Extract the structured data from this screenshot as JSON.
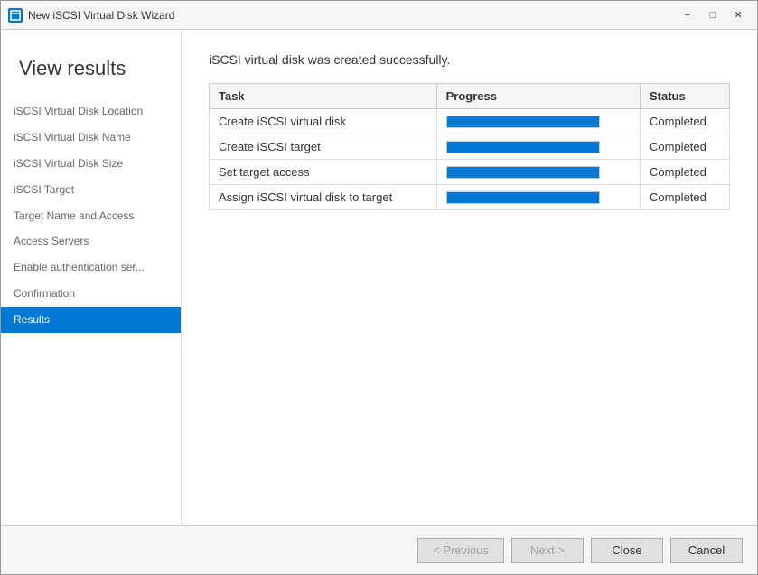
{
  "window": {
    "title": "New iSCSI Virtual Disk Wizard",
    "icon": "disk"
  },
  "titlebar": {
    "minimize_label": "−",
    "maximize_label": "□",
    "close_label": "✕"
  },
  "sidebar": {
    "page_title": "View results",
    "nav_items": [
      {
        "id": "iscsi-location",
        "label": "iSCSI Virtual Disk Location",
        "active": false
      },
      {
        "id": "iscsi-name",
        "label": "iSCSI Virtual Disk Name",
        "active": false
      },
      {
        "id": "iscsi-size",
        "label": "iSCSI Virtual Disk Size",
        "active": false
      },
      {
        "id": "iscsi-target",
        "label": "iSCSI Target",
        "active": false
      },
      {
        "id": "target-name-access",
        "label": "Target Name and Access",
        "active": false
      },
      {
        "id": "access-servers",
        "label": "Access Servers",
        "active": false
      },
      {
        "id": "enable-auth",
        "label": "Enable authentication ser...",
        "active": false
      },
      {
        "id": "confirmation",
        "label": "Confirmation",
        "active": false
      },
      {
        "id": "results",
        "label": "Results",
        "active": true
      }
    ]
  },
  "main": {
    "success_message": "iSCSI virtual disk was created successfully.",
    "table": {
      "columns": [
        "Task",
        "Progress",
        "Status"
      ],
      "rows": [
        {
          "task": "Create iSCSI virtual disk",
          "status": "Completed",
          "progress": 100
        },
        {
          "task": "Create iSCSI target",
          "status": "Completed",
          "progress": 100
        },
        {
          "task": "Set target access",
          "status": "Completed",
          "progress": 100
        },
        {
          "task": "Assign iSCSI virtual disk to target",
          "status": "Completed",
          "progress": 100
        }
      ]
    }
  },
  "footer": {
    "previous_label": "< Previous",
    "next_label": "Next >",
    "close_label": "Close",
    "cancel_label": "Cancel"
  }
}
